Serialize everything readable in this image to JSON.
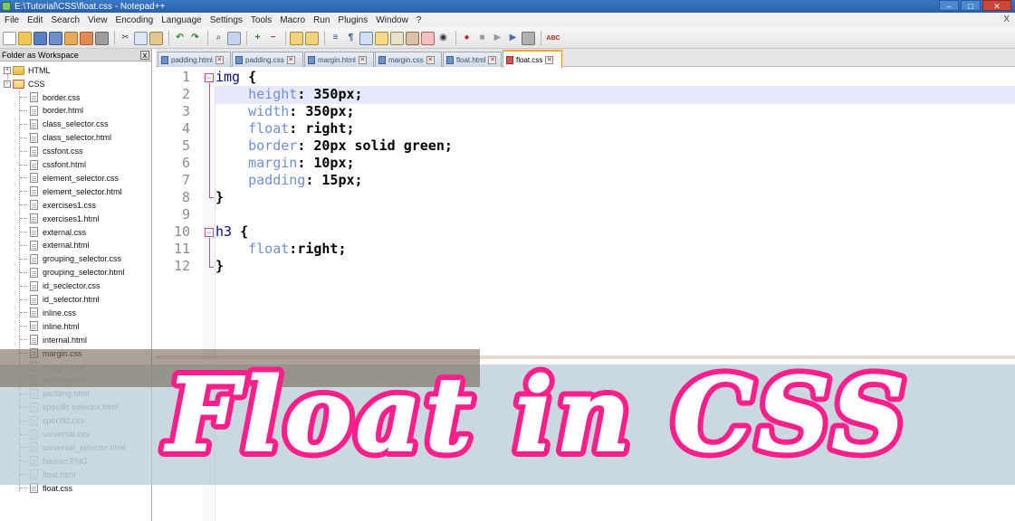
{
  "window": {
    "title": "E:\\Tutorial\\CSS\\float.css - Notepad++",
    "buttons": [
      "–",
      "□",
      "✕"
    ]
  },
  "menu": {
    "items": [
      "File",
      "Edit",
      "Search",
      "View",
      "Encoding",
      "Language",
      "Settings",
      "Tools",
      "Macro",
      "Run",
      "Plugins",
      "Window",
      "?"
    ],
    "close_glyph": "X"
  },
  "toolbar": {
    "spellcheck_label": "ABC"
  },
  "panel": {
    "title": "Folder as Workspace",
    "close_glyph": "x",
    "folders": [
      {
        "label": "HTML",
        "expander": "+"
      },
      {
        "label": "CSS",
        "expander": "-"
      }
    ],
    "files": [
      "border.css",
      "border.html",
      "class_selector.css",
      "class_selector.html",
      "cssfont.css",
      "cssfont.html",
      "element_selector.css",
      "element_selector.html",
      "exercises1.css",
      "exercises1.html",
      "external.css",
      "external.html",
      "grouping_selector.css",
      "grouping_selector.html",
      "id_seclector.css",
      "id_selector.html",
      "inline.css",
      "inline.html",
      "internal.html",
      "margin.css",
      "margin.html",
      "padding.css",
      "padding.html",
      "specific selector.html",
      "specific.css",
      "universal.css",
      "universal_selector.html",
      "banner.PNG",
      "float.html",
      "float.css"
    ]
  },
  "tabs": [
    {
      "label": "padding.html",
      "active": false
    },
    {
      "label": "padding.css",
      "active": false
    },
    {
      "label": "margin.html",
      "active": false
    },
    {
      "label": "margin.css",
      "active": false
    },
    {
      "label": "float.html",
      "active": false
    },
    {
      "label": "float.css",
      "active": true
    }
  ],
  "editor": {
    "line_numbers": [
      "1",
      "2",
      "3",
      "4",
      "5",
      "6",
      "7",
      "8",
      "9",
      "10",
      "11",
      "12"
    ],
    "lines": [
      [
        {
          "t": "img",
          "c": "sel"
        },
        {
          "t": " ",
          "c": ""
        },
        {
          "t": "{",
          "c": "brace"
        }
      ],
      [
        {
          "t": "    height",
          "c": "prop"
        },
        {
          "t": ":",
          "c": "punct"
        },
        {
          "t": " 350px;",
          "c": "val"
        }
      ],
      [
        {
          "t": "    width",
          "c": "prop"
        },
        {
          "t": ":",
          "c": "punct"
        },
        {
          "t": " 350px;",
          "c": "val"
        }
      ],
      [
        {
          "t": "    float",
          "c": "prop"
        },
        {
          "t": ":",
          "c": "punct"
        },
        {
          "t": " right;",
          "c": "val"
        }
      ],
      [
        {
          "t": "    border",
          "c": "prop"
        },
        {
          "t": ":",
          "c": "punct"
        },
        {
          "t": " 20px solid green;",
          "c": "val"
        }
      ],
      [
        {
          "t": "    margin",
          "c": "prop"
        },
        {
          "t": ":",
          "c": "punct"
        },
        {
          "t": " 10px;",
          "c": "val"
        }
      ],
      [
        {
          "t": "    padding",
          "c": "prop"
        },
        {
          "t": ":",
          "c": "punct"
        },
        {
          "t": " 15px;",
          "c": "val"
        }
      ],
      [
        {
          "t": "}",
          "c": "brace"
        }
      ],
      [],
      [
        {
          "t": "h3",
          "c": "sel"
        },
        {
          "t": " ",
          "c": ""
        },
        {
          "t": "{",
          "c": "brace"
        }
      ],
      [
        {
          "t": "    float",
          "c": "prop"
        },
        {
          "t": ":",
          "c": "punct"
        },
        {
          "t": "right;",
          "c": "val"
        }
      ],
      [
        {
          "t": "}",
          "c": "brace"
        }
      ]
    ],
    "fold_open_glyph": "−"
  },
  "overlay": {
    "text": "Float in CSS",
    "color": "#ff1f8a"
  }
}
